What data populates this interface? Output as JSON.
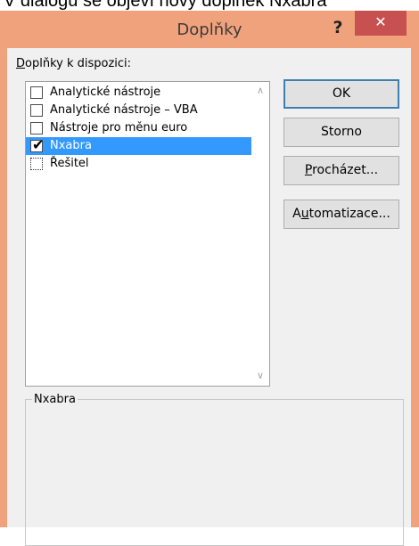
{
  "caption_text": "V dialogu se objeví nový doplněk Nxabra",
  "window": {
    "title": "Doplňky",
    "help_label": "?",
    "close_label": "✕"
  },
  "list": {
    "label": "Doplňky k dispozici:",
    "items": [
      {
        "label": "Analytické nástroje",
        "checked": false
      },
      {
        "label": "Analytické nástroje – VBA",
        "checked": false
      },
      {
        "label": "Nástroje pro měnu euro",
        "checked": false
      },
      {
        "label": "Nxabra",
        "checked": true,
        "selected": true
      },
      {
        "label": "Řešitel",
        "checked": false
      }
    ],
    "scroll_up": "∧",
    "scroll_down": "∨"
  },
  "buttons": {
    "ok": "OK",
    "cancel": "Storno",
    "browse": "Procházet...",
    "automation": "Automatizace..."
  },
  "description": {
    "title": "Nxabra"
  }
}
